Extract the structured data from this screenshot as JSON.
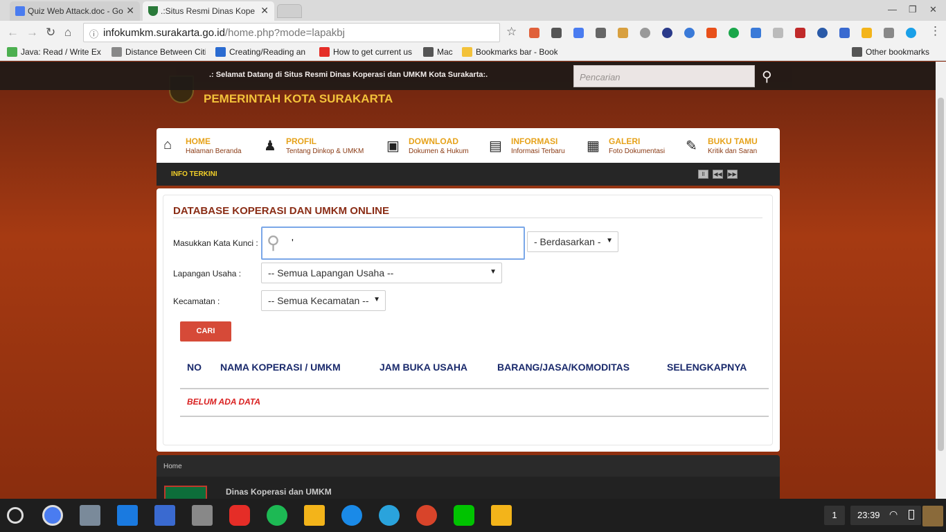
{
  "browser": {
    "tabs": [
      {
        "title": "Quiz Web Attack.doc - Go",
        "icon": "docs-icon",
        "active": false
      },
      {
        "title": ".:Situs Resmi Dinas Kope",
        "icon": "site-crest-icon",
        "active": true
      }
    ],
    "close_glyph": "✕",
    "url_host": "infokumkm.surakarta.go.id",
    "url_path": "/home.php?mode=lapakbj",
    "bookmarks": [
      {
        "label": "Java: Read / Write Ex",
        "color": "#4caf50"
      },
      {
        "label": "Distance Between Citi",
        "color": "#888888"
      },
      {
        "label": "Creating/Reading an",
        "color": "#2a6bd1"
      },
      {
        "label": "How to get current us",
        "color": "#e52d27"
      },
      {
        "label": "Mac",
        "color": "#555555"
      },
      {
        "label": "Bookmarks bar - Book",
        "color": "#f3c23a"
      }
    ],
    "other_bookmarks": "Other bookmarks"
  },
  "site": {
    "welcome": ".: Selamat Datang di Situs Resmi Dinas Koperasi dan UMKM Kota Surakarta:.",
    "search_placeholder": "Pencarian",
    "title": "PEMERINTAH KOTA SURAKARTA",
    "menu": [
      {
        "title": "HOME",
        "sub": "Halaman Beranda",
        "icon": "home-icon"
      },
      {
        "title": "PROFIL",
        "sub": "Tentang Dinkop & UMKM",
        "icon": "profile-icon"
      },
      {
        "title": "DOWNLOAD",
        "sub": "Dokumen & Hukum",
        "icon": "save-icon"
      },
      {
        "title": "INFORMASI",
        "sub": "Informasi Terbaru",
        "icon": "newspaper-icon"
      },
      {
        "title": "GALERI",
        "sub": "Foto Dokumentasi",
        "icon": "gallery-icon"
      },
      {
        "title": "BUKU TAMU",
        "sub": "Kritik dan Saran",
        "icon": "guestbook-icon"
      }
    ],
    "info_label": "INFO TERKINI",
    "db": {
      "title": "DATABASE KOPERASI DAN UMKM ONLINE",
      "keyword_label": "Masukkan Kata Kunci :",
      "keyword_value": "'",
      "by_select": "- Berdasarkan -",
      "field_label": "Lapangan Usaha :",
      "field_select": "-- Semua Lapangan Usaha --",
      "district_label": "Kecamatan :",
      "district_select": "-- Semua Kecamatan --",
      "search_button": "CARI",
      "columns": [
        "NO",
        "NAMA KOPERASI / UMKM",
        "JAM BUKA USAHA",
        "BARANG/JASA/KOMODITAS",
        "SELENGKAPNYA"
      ],
      "empty": "BELUM ADA DATA"
    },
    "footer": {
      "breadcrumb": "Home",
      "org": "Dinas Koperasi dan UMKM"
    }
  },
  "shelf": {
    "notifications": "1",
    "time": "23:39"
  }
}
